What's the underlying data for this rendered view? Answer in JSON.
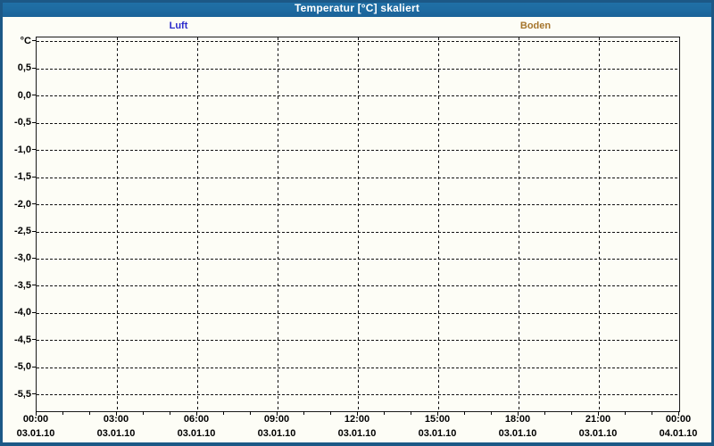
{
  "window": {
    "title": "Temperatur [°C] skaliert"
  },
  "legend": {
    "items": [
      {
        "label": "Luft",
        "color": "#2929cc"
      },
      {
        "label": "Boden",
        "color": "#a5742c"
      }
    ]
  },
  "chart_data": {
    "type": "line",
    "title": "Temperatur [°C] skaliert",
    "y_unit_label": "°C",
    "series": [
      {
        "name": "Luft",
        "color": "#2929cc",
        "x": [],
        "values": []
      },
      {
        "name": "Boden",
        "color": "#a5742c",
        "x": [],
        "values": []
      }
    ],
    "x_axis": {
      "major_ticks": [
        {
          "time": "00:00",
          "date": "03.01.10"
        },
        {
          "time": "03:00",
          "date": "03.01.10"
        },
        {
          "time": "06:00",
          "date": "03.01.10"
        },
        {
          "time": "09:00",
          "date": "03.01.10"
        },
        {
          "time": "12:00",
          "date": "03.01.10"
        },
        {
          "time": "15:00",
          "date": "03.01.10"
        },
        {
          "time": "18:00",
          "date": "03.01.10"
        },
        {
          "time": "21:00",
          "date": "03.01.10"
        },
        {
          "time": "00:00",
          "date": "04.01.10"
        }
      ],
      "hours_range": [
        0,
        24
      ],
      "major_step_hours": 3,
      "minor_step_hours": 1
    },
    "y_axis": {
      "tick_labels": [
        "°C",
        "0,5",
        "0,0",
        "-0,5",
        "-1,0",
        "-1,5",
        "-2,0",
        "-2,5",
        "-3,0",
        "-3,5",
        "-4,0",
        "-4,5",
        "-5,0",
        "-5,5"
      ],
      "tick_values": [
        1.0,
        0.5,
        0.0,
        -0.5,
        -1.0,
        -1.5,
        -2.0,
        -2.5,
        -3.0,
        -3.5,
        -4.0,
        -4.5,
        -5.0,
        -5.5
      ],
      "ylim": [
        -5.8,
        1.08
      ]
    },
    "grid": "dashed",
    "legend_position": "top"
  }
}
